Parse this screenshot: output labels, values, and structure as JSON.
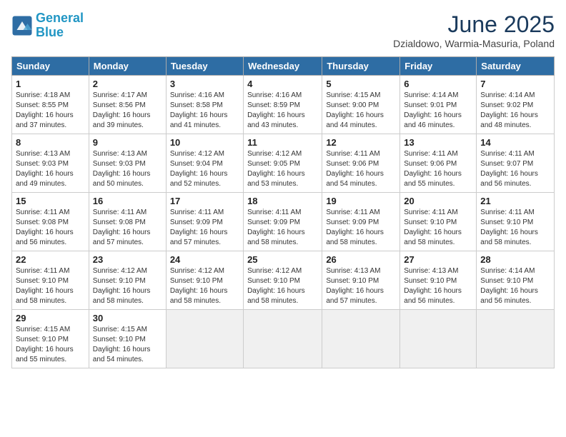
{
  "header": {
    "logo_line1": "General",
    "logo_line2": "Blue",
    "title": "June 2025",
    "location": "Dzialdowo, Warmia-Masuria, Poland"
  },
  "days_of_week": [
    "Sunday",
    "Monday",
    "Tuesday",
    "Wednesday",
    "Thursday",
    "Friday",
    "Saturday"
  ],
  "weeks": [
    [
      {
        "day": "1",
        "info": "Sunrise: 4:18 AM\nSunset: 8:55 PM\nDaylight: 16 hours\nand 37 minutes."
      },
      {
        "day": "2",
        "info": "Sunrise: 4:17 AM\nSunset: 8:56 PM\nDaylight: 16 hours\nand 39 minutes."
      },
      {
        "day": "3",
        "info": "Sunrise: 4:16 AM\nSunset: 8:58 PM\nDaylight: 16 hours\nand 41 minutes."
      },
      {
        "day": "4",
        "info": "Sunrise: 4:16 AM\nSunset: 8:59 PM\nDaylight: 16 hours\nand 43 minutes."
      },
      {
        "day": "5",
        "info": "Sunrise: 4:15 AM\nSunset: 9:00 PM\nDaylight: 16 hours\nand 44 minutes."
      },
      {
        "day": "6",
        "info": "Sunrise: 4:14 AM\nSunset: 9:01 PM\nDaylight: 16 hours\nand 46 minutes."
      },
      {
        "day": "7",
        "info": "Sunrise: 4:14 AM\nSunset: 9:02 PM\nDaylight: 16 hours\nand 48 minutes."
      }
    ],
    [
      {
        "day": "8",
        "info": "Sunrise: 4:13 AM\nSunset: 9:03 PM\nDaylight: 16 hours\nand 49 minutes."
      },
      {
        "day": "9",
        "info": "Sunrise: 4:13 AM\nSunset: 9:03 PM\nDaylight: 16 hours\nand 50 minutes."
      },
      {
        "day": "10",
        "info": "Sunrise: 4:12 AM\nSunset: 9:04 PM\nDaylight: 16 hours\nand 52 minutes."
      },
      {
        "day": "11",
        "info": "Sunrise: 4:12 AM\nSunset: 9:05 PM\nDaylight: 16 hours\nand 53 minutes."
      },
      {
        "day": "12",
        "info": "Sunrise: 4:11 AM\nSunset: 9:06 PM\nDaylight: 16 hours\nand 54 minutes."
      },
      {
        "day": "13",
        "info": "Sunrise: 4:11 AM\nSunset: 9:06 PM\nDaylight: 16 hours\nand 55 minutes."
      },
      {
        "day": "14",
        "info": "Sunrise: 4:11 AM\nSunset: 9:07 PM\nDaylight: 16 hours\nand 56 minutes."
      }
    ],
    [
      {
        "day": "15",
        "info": "Sunrise: 4:11 AM\nSunset: 9:08 PM\nDaylight: 16 hours\nand 56 minutes."
      },
      {
        "day": "16",
        "info": "Sunrise: 4:11 AM\nSunset: 9:08 PM\nDaylight: 16 hours\nand 57 minutes."
      },
      {
        "day": "17",
        "info": "Sunrise: 4:11 AM\nSunset: 9:09 PM\nDaylight: 16 hours\nand 57 minutes."
      },
      {
        "day": "18",
        "info": "Sunrise: 4:11 AM\nSunset: 9:09 PM\nDaylight: 16 hours\nand 58 minutes."
      },
      {
        "day": "19",
        "info": "Sunrise: 4:11 AM\nSunset: 9:09 PM\nDaylight: 16 hours\nand 58 minutes."
      },
      {
        "day": "20",
        "info": "Sunrise: 4:11 AM\nSunset: 9:10 PM\nDaylight: 16 hours\nand 58 minutes."
      },
      {
        "day": "21",
        "info": "Sunrise: 4:11 AM\nSunset: 9:10 PM\nDaylight: 16 hours\nand 58 minutes."
      }
    ],
    [
      {
        "day": "22",
        "info": "Sunrise: 4:11 AM\nSunset: 9:10 PM\nDaylight: 16 hours\nand 58 minutes."
      },
      {
        "day": "23",
        "info": "Sunrise: 4:12 AM\nSunset: 9:10 PM\nDaylight: 16 hours\nand 58 minutes."
      },
      {
        "day": "24",
        "info": "Sunrise: 4:12 AM\nSunset: 9:10 PM\nDaylight: 16 hours\nand 58 minutes."
      },
      {
        "day": "25",
        "info": "Sunrise: 4:12 AM\nSunset: 9:10 PM\nDaylight: 16 hours\nand 58 minutes."
      },
      {
        "day": "26",
        "info": "Sunrise: 4:13 AM\nSunset: 9:10 PM\nDaylight: 16 hours\nand 57 minutes."
      },
      {
        "day": "27",
        "info": "Sunrise: 4:13 AM\nSunset: 9:10 PM\nDaylight: 16 hours\nand 56 minutes."
      },
      {
        "day": "28",
        "info": "Sunrise: 4:14 AM\nSunset: 9:10 PM\nDaylight: 16 hours\nand 56 minutes."
      }
    ],
    [
      {
        "day": "29",
        "info": "Sunrise: 4:15 AM\nSunset: 9:10 PM\nDaylight: 16 hours\nand 55 minutes."
      },
      {
        "day": "30",
        "info": "Sunrise: 4:15 AM\nSunset: 9:10 PM\nDaylight: 16 hours\nand 54 minutes."
      },
      null,
      null,
      null,
      null,
      null
    ]
  ]
}
